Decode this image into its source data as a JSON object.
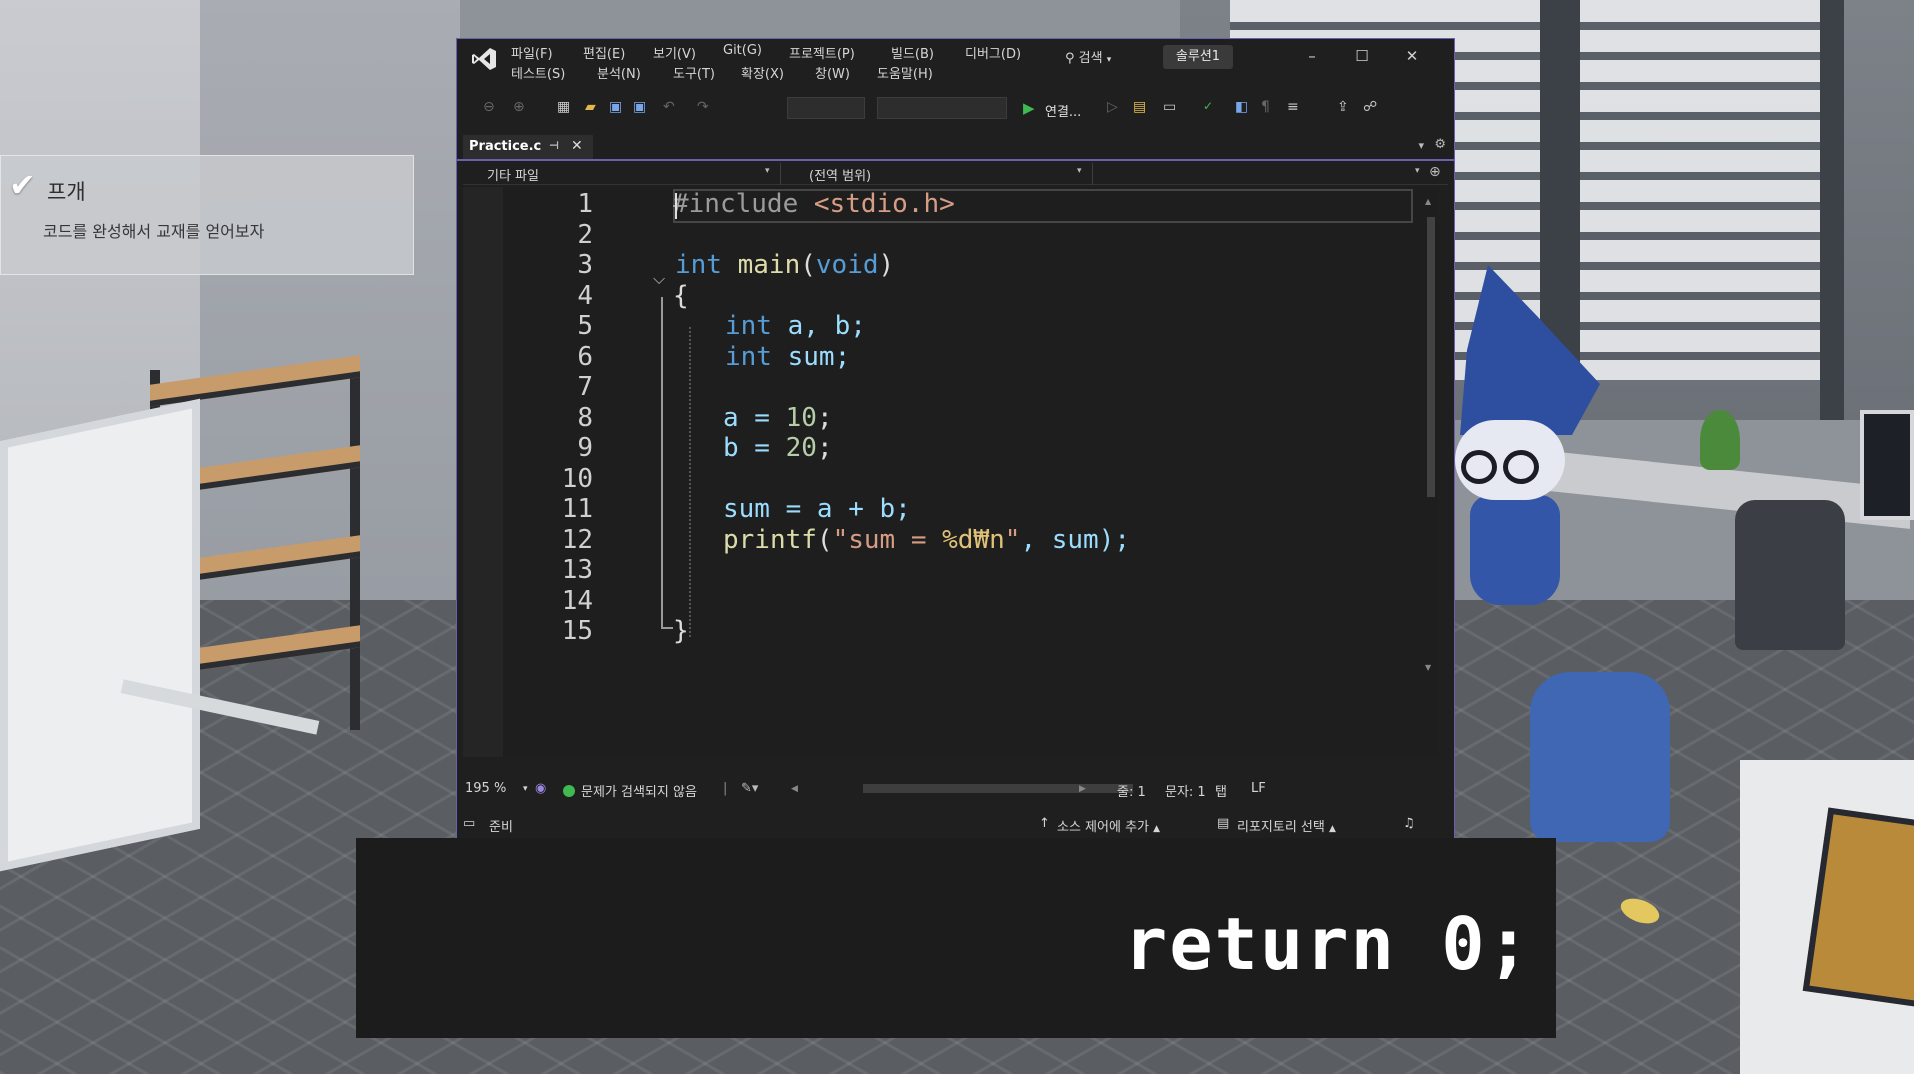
{
  "quest": {
    "title": "프개",
    "description": "코드를 완성해서 교재를 얻어보자"
  },
  "ide": {
    "menu_row1": [
      "파일(F)",
      "편집(E)",
      "보기(V)",
      "Git(G)",
      "프로젝트(P)",
      "빌드(B)",
      "디버그(D)"
    ],
    "menu_row2": [
      "테스트(S)",
      "분석(N)",
      "도구(T)",
      "확장(X)",
      "창(W)",
      "도움말(H)"
    ],
    "search_label": "검색",
    "solution_name": "솔루션1",
    "run_label": "연결...",
    "tab": {
      "filename": "Practice.c"
    },
    "nav": {
      "project": "기타 파일",
      "scope": "(전역 범위)"
    },
    "line_numbers": [
      "1",
      "2",
      "3",
      "4",
      "5",
      "6",
      "7",
      "8",
      "9",
      "10",
      "11",
      "12",
      "13",
      "14",
      "15"
    ],
    "editor_status": {
      "zoom": "195 %",
      "issues": "문제가 검색되지 않음",
      "line": "줄: 1",
      "col": "문자: 1",
      "tab": "탭",
      "eol": "LF"
    },
    "statusbar": {
      "ready": "준비",
      "source_control": "소스 제어에 추가",
      "repository": "리포지토리 선택"
    },
    "colors": {
      "accent": "#6b5fb0",
      "keyword": "#569cd6",
      "string": "#d69d85",
      "number": "#b5cea8"
    }
  },
  "code": {
    "l1_pp": "#include",
    "l1_header": " <stdio.h>",
    "l3_kw": "int",
    "l3_fn": " main",
    "l3_open": "(",
    "l3_param": "void",
    "l3_close": ")",
    "l4": "{",
    "l5_kw": "int",
    "l5_rest": " a, b;",
    "l6_kw": "int",
    "l6_rest": " sum;",
    "l8_a": "a = ",
    "l8_n": "10",
    "l8_e": ";",
    "l9_a": "b = ",
    "l9_n": "20",
    "l9_e": ";",
    "l11": "sum = a + b;",
    "l12_fn": "printf",
    "l12_open": "(",
    "l12_str": "\"sum = ",
    "l12_fmt": "%d",
    "l12_esc": "₩n",
    "l12_q": "\"",
    "l12_rest": ", sum);",
    "l15": "}"
  },
  "subtitle": "return 0;"
}
